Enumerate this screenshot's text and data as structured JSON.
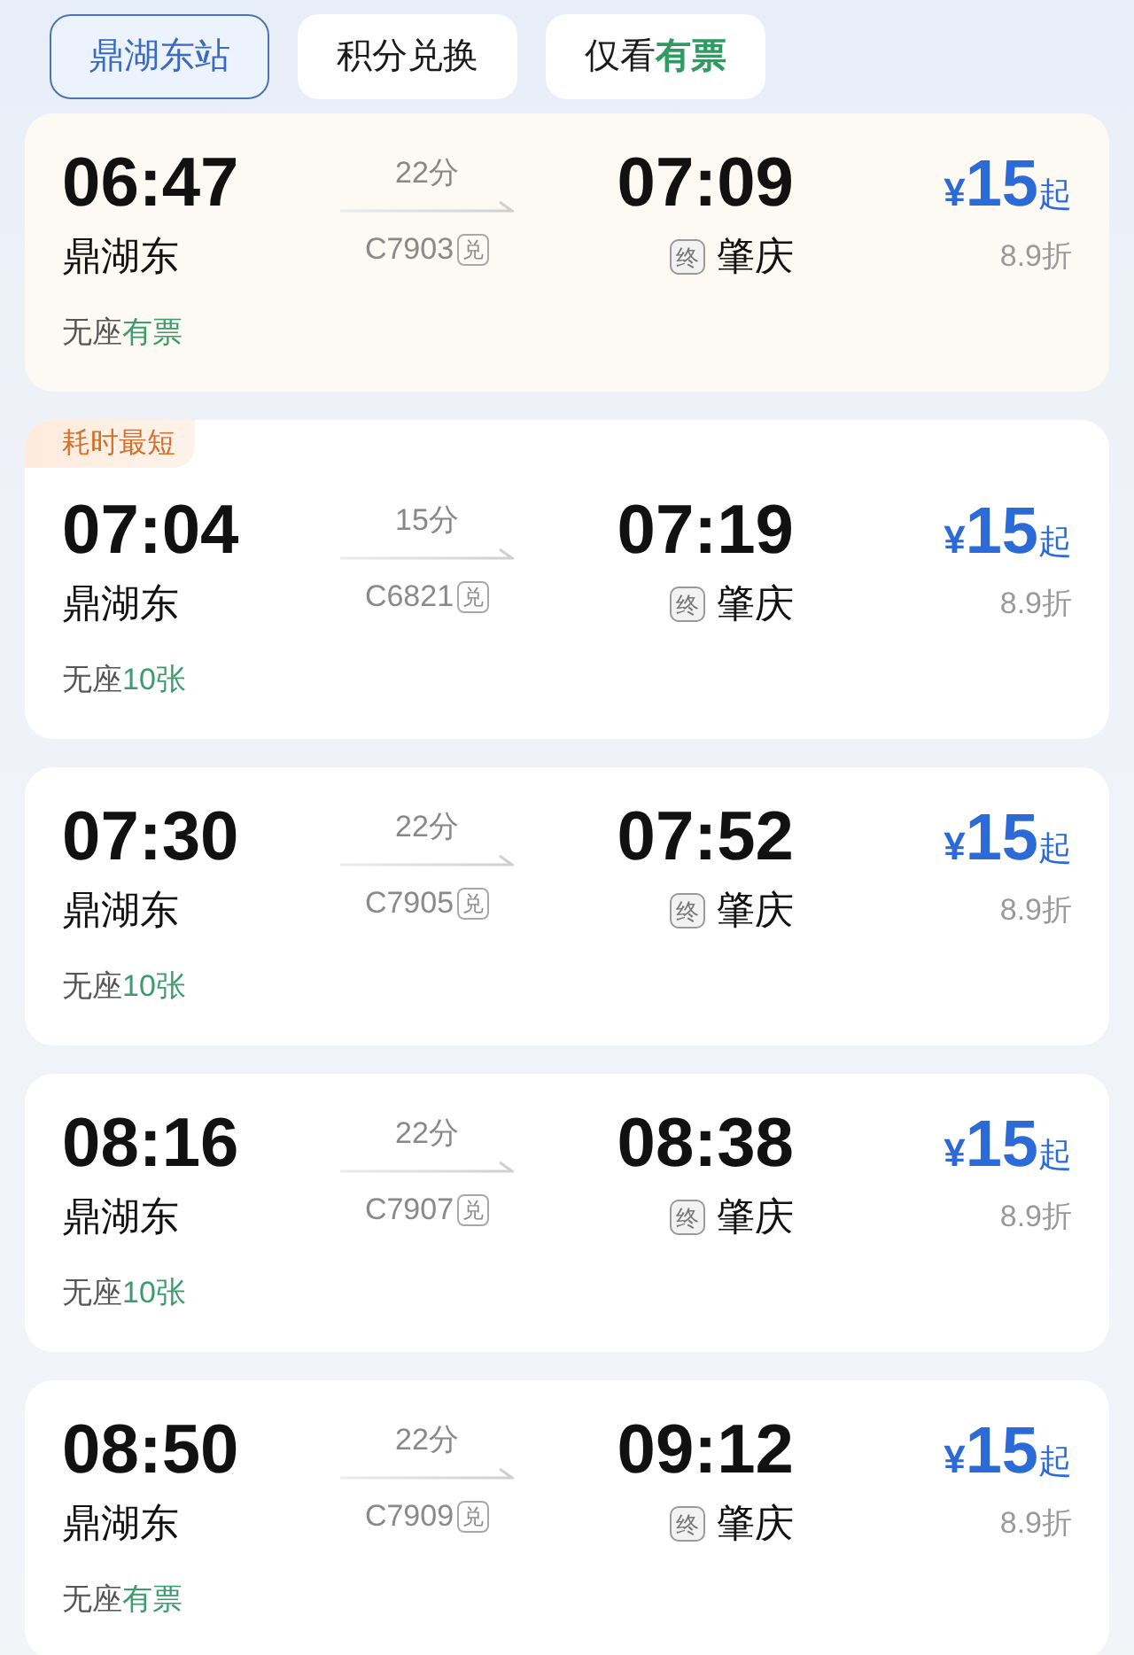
{
  "filters": [
    {
      "label": "鼎湖东站",
      "selected": true
    },
    {
      "label": "积分兑换",
      "selected": false
    },
    {
      "label": "仅看**有票**",
      "selected": false
    }
  ],
  "trains": [
    {
      "selected": true,
      "depart_time": "06:47",
      "depart_station": "鼎湖东",
      "duration": "22分",
      "train_no": "C7903",
      "train_mark": "兑",
      "arrive_time": "07:09",
      "arrive_mark": "终",
      "arrive_station": "肇庆",
      "currency": "¥",
      "price": "15",
      "price_suffix": "起",
      "discount": "8.9折",
      "seat_class": "无座",
      "availability": "有票"
    },
    {
      "selected": false,
      "tag": "耗时最短",
      "depart_time": "07:04",
      "depart_station": "鼎湖东",
      "duration": "15分",
      "train_no": "C6821",
      "train_mark": "兑",
      "arrive_time": "07:19",
      "arrive_mark": "终",
      "arrive_station": "肇庆",
      "currency": "¥",
      "price": "15",
      "price_suffix": "起",
      "discount": "8.9折",
      "seat_class": "无座",
      "availability": "10张"
    },
    {
      "selected": false,
      "depart_time": "07:30",
      "depart_station": "鼎湖东",
      "duration": "22分",
      "train_no": "C7905",
      "train_mark": "兑",
      "arrive_time": "07:52",
      "arrive_mark": "终",
      "arrive_station": "肇庆",
      "currency": "¥",
      "price": "15",
      "price_suffix": "起",
      "discount": "8.9折",
      "seat_class": "无座",
      "availability": "10张"
    },
    {
      "selected": false,
      "depart_time": "08:16",
      "depart_station": "鼎湖东",
      "duration": "22分",
      "train_no": "C7907",
      "train_mark": "兑",
      "arrive_time": "08:38",
      "arrive_mark": "终",
      "arrive_station": "肇庆",
      "currency": "¥",
      "price": "15",
      "price_suffix": "起",
      "discount": "8.9折",
      "seat_class": "无座",
      "availability": "10张"
    },
    {
      "selected": false,
      "depart_time": "08:50",
      "depart_station": "鼎湖东",
      "duration": "22分",
      "train_no": "C7909",
      "train_mark": "兑",
      "arrive_time": "09:12",
      "arrive_mark": "终",
      "arrive_station": "肇庆",
      "currency": "¥",
      "price": "15",
      "price_suffix": "起",
      "discount": "8.9折",
      "seat_class": "无座",
      "availability": "有票"
    }
  ]
}
